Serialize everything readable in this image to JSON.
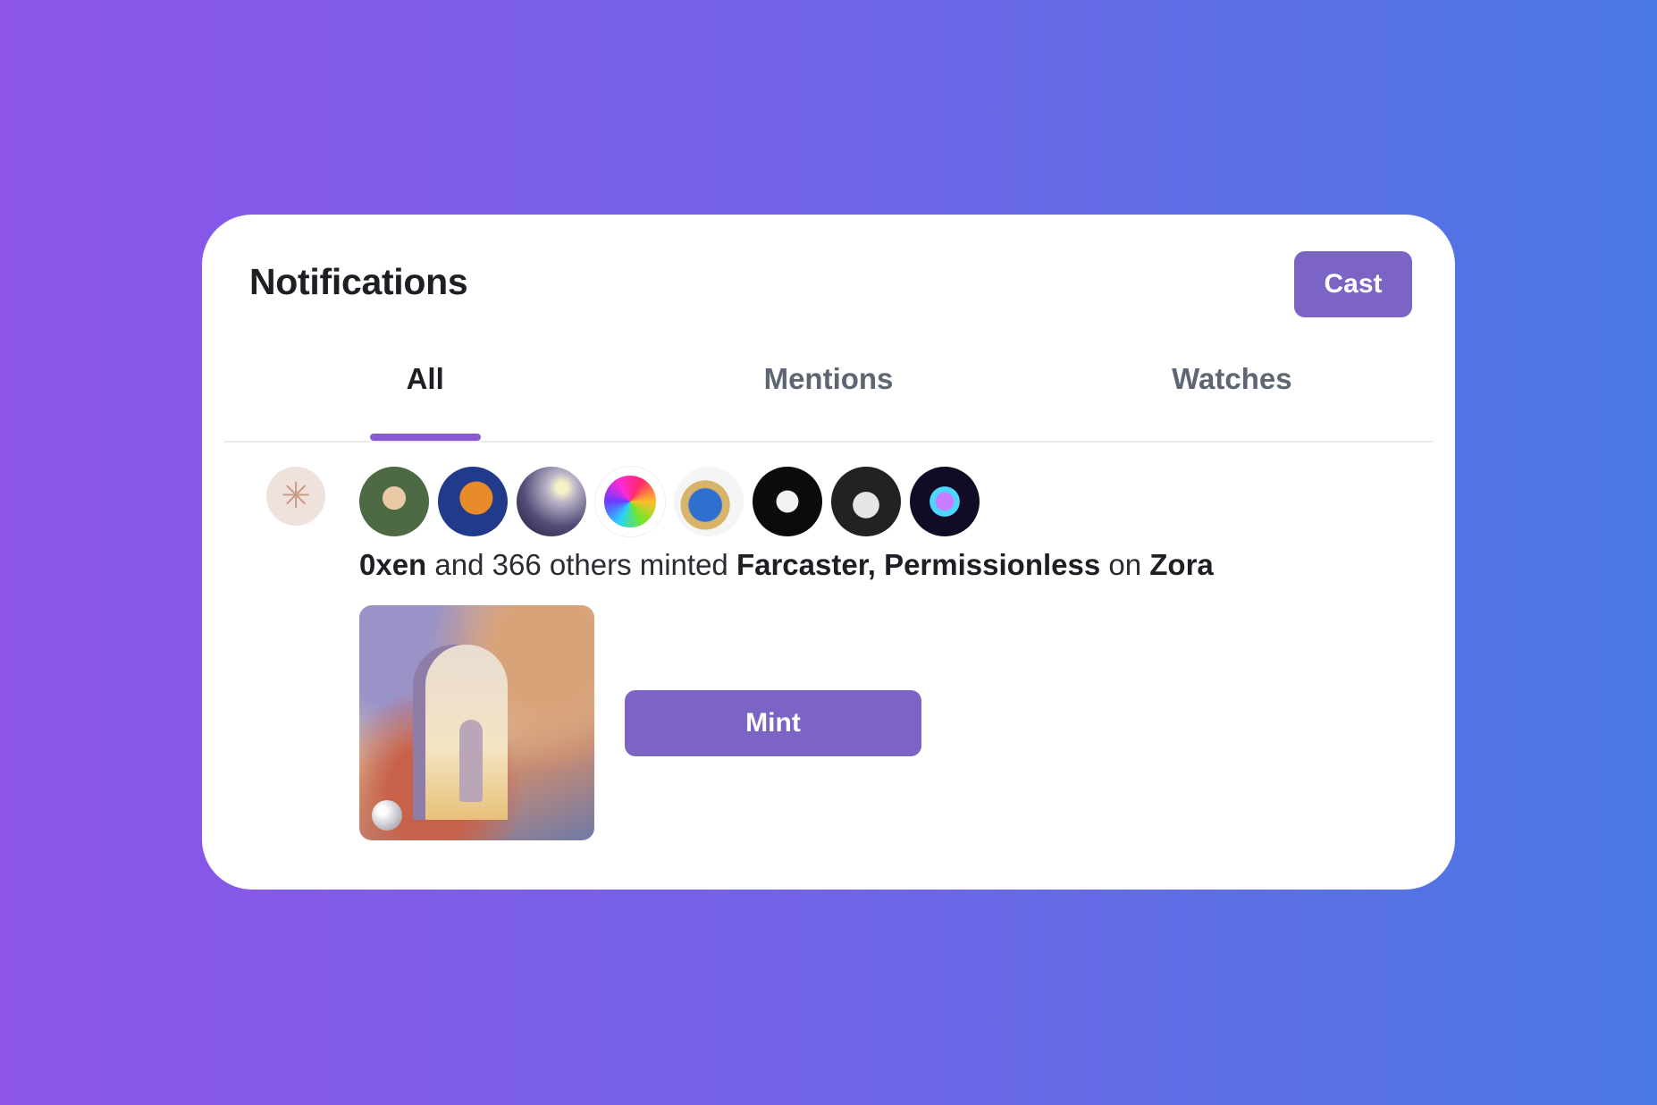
{
  "header": {
    "title": "Notifications",
    "cast_label": "Cast"
  },
  "tabs": [
    {
      "label": "All",
      "active": true
    },
    {
      "label": "Mentions",
      "active": false
    },
    {
      "label": "Watches",
      "active": false
    }
  ],
  "notification": {
    "icon": "sparkle-icon",
    "avatars": [
      "avatar-1",
      "avatar-2",
      "avatar-3",
      "avatar-4",
      "avatar-5",
      "avatar-6",
      "avatar-7",
      "avatar-8"
    ],
    "actor": "0xen",
    "middle_text": "and 366 others minted",
    "collection": "Farcaster, Permissionless",
    "on_text": "on",
    "platform": "Zora",
    "mint_label": "Mint"
  },
  "colors": {
    "accent": "#7c64c4",
    "tab_indicator": "#8a5ad6",
    "background_start": "#8c55e8",
    "background_end": "#4a78e4"
  }
}
